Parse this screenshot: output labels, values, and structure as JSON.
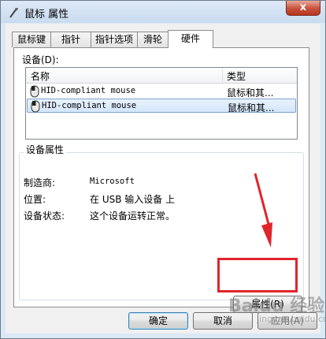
{
  "window": {
    "title": "鼠标 属性",
    "close_glyph": "x"
  },
  "tabs": [
    {
      "label": "鼠标键"
    },
    {
      "label": "指针"
    },
    {
      "label": "指针选项"
    },
    {
      "label": "滑轮"
    },
    {
      "label": "硬件",
      "active": true
    }
  ],
  "devices": {
    "label": "设备(D):",
    "columns": {
      "name": "名称",
      "type": "类型"
    },
    "rows": [
      {
        "name": "HID-compliant mouse",
        "type": "鼠标和其...",
        "selected": false
      },
      {
        "name": "HID-compliant mouse",
        "type": "鼠标和其...",
        "selected": true
      }
    ]
  },
  "device_properties": {
    "title": "设备属性",
    "manufacturer_label": "制造商:",
    "manufacturer": "Microsoft",
    "location_label": "位置:",
    "location": "在 USB 输入设备 上",
    "status_label": "设备状态:",
    "status": "这个设备运转正常。",
    "properties_button": "属性(R)"
  },
  "buttons": {
    "ok": "确定",
    "cancel": "取消",
    "apply": "应用(A)"
  },
  "annotation": {
    "color": "#e0242b"
  },
  "watermark": {
    "text": "Baidu 经验",
    "sub": "jingyan.baidu.com"
  }
}
